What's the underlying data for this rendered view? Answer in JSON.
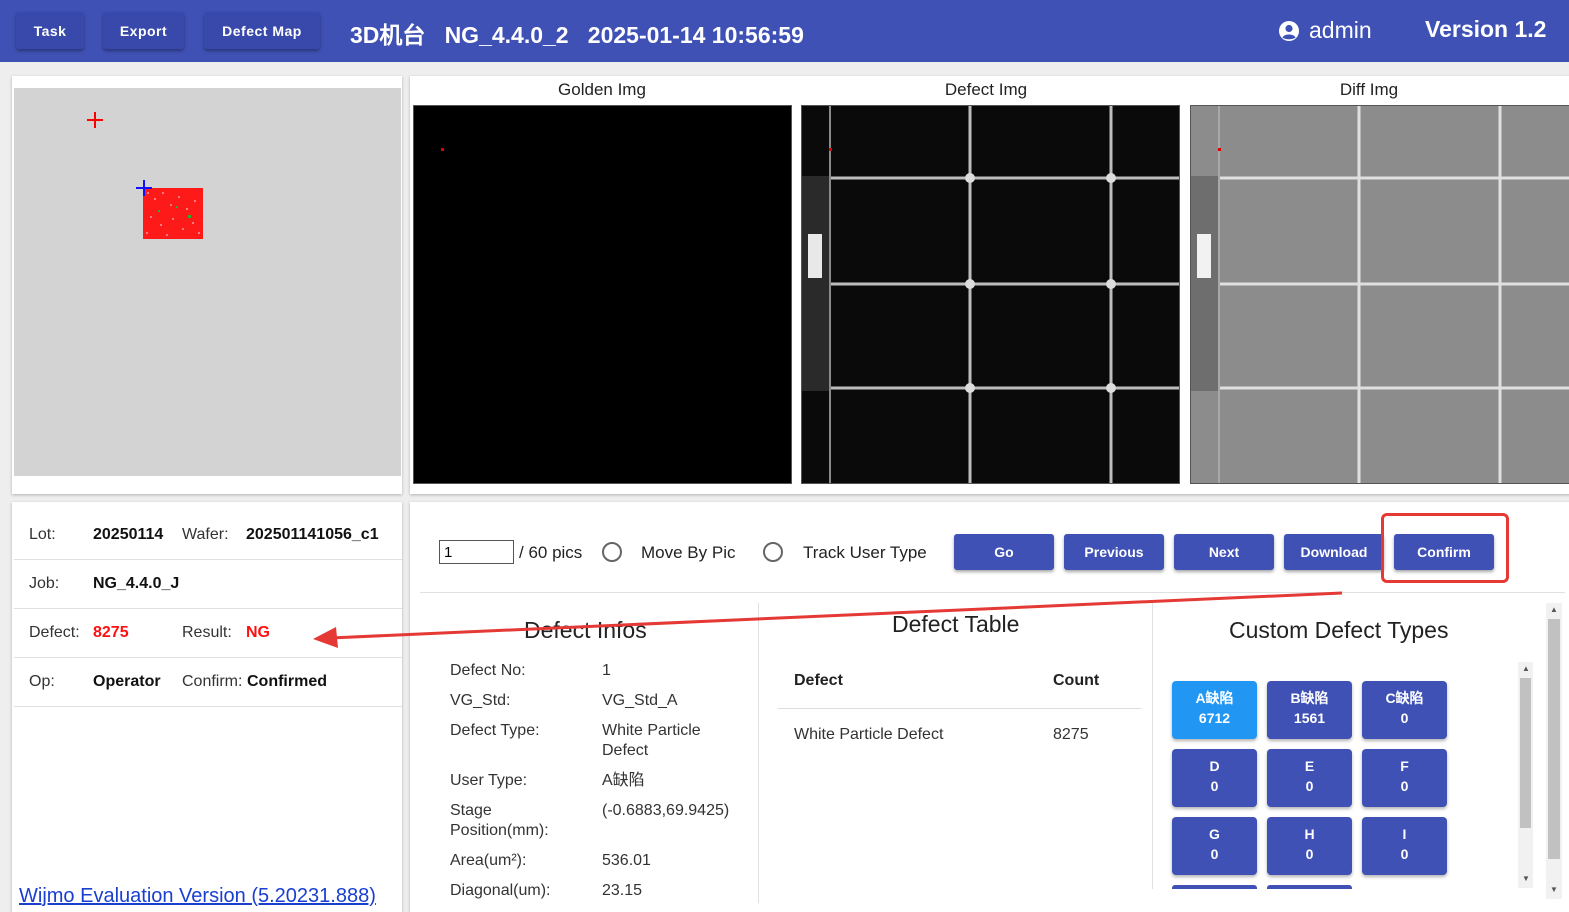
{
  "topbar": {
    "buttons": [
      "Task",
      "Export",
      "Defect Map"
    ],
    "title": "3D机台   NG_4.4.0_2   2025-01-14 10:56:59",
    "user": "admin",
    "version": "Version 1.2"
  },
  "images": {
    "golden_title": "Golden Img",
    "defect_title": "Defect Img",
    "diff_title": "Diff Img"
  },
  "info": {
    "lot_label": "Lot:",
    "lot": "20250114",
    "wafer_label": "Wafer:",
    "wafer": "202501141056_c1",
    "job_label": "Job:",
    "job": "NG_4.4.0_J",
    "defect_label": "Defect:",
    "defect": "8275",
    "result_label": "Result:",
    "result": "NG",
    "op_label": "Op:",
    "op": "Operator",
    "confirm_label": "Confirm:",
    "confirm": "Confirmed"
  },
  "watermark": "Wijmo Evaluation Version (5.20231.888)",
  "controls": {
    "pic_value": "1",
    "pic_total": "/ 60 pics",
    "move_by_pic": "Move By Pic",
    "track_user_type": "Track User Type",
    "go": "Go",
    "previous": "Previous",
    "next": "Next",
    "download": "Download",
    "confirm": "Confirm"
  },
  "defect_infos": {
    "title": "Defect Infos",
    "rows": [
      {
        "label": "Defect No:",
        "value": "1"
      },
      {
        "label": "VG_Std:",
        "value": "VG_Std_A"
      },
      {
        "label": "Defect Type:",
        "value": "White Particle Defect"
      },
      {
        "label": "User Type:",
        "value": "A缺陷"
      },
      {
        "label": "Stage Position(mm):",
        "value": "(-0.6883,69.9425)"
      },
      {
        "label": "Area(um²):",
        "value": "536.01"
      },
      {
        "label": "Diagonal(um):",
        "value": "23.15"
      }
    ]
  },
  "defect_table": {
    "title": "Defect Table",
    "headers": [
      "Defect",
      "Count"
    ],
    "rows": [
      {
        "defect": "White Particle Defect",
        "count": "8275"
      }
    ]
  },
  "custom_types": {
    "title": "Custom Defect Types",
    "buttons": [
      {
        "name": "A缺陷",
        "count": "6712"
      },
      {
        "name": "B缺陷",
        "count": "1561"
      },
      {
        "name": "C缺陷",
        "count": "0"
      },
      {
        "name": "D",
        "count": "0"
      },
      {
        "name": "E",
        "count": "0"
      },
      {
        "name": "F",
        "count": "0"
      },
      {
        "name": "G",
        "count": "0"
      },
      {
        "name": "H",
        "count": "0"
      },
      {
        "name": "I",
        "count": "0"
      }
    ]
  },
  "colors": {
    "primary": "#3f51b5",
    "active": "#2196f3",
    "alert": "#ff1010",
    "annotation": "#e53935"
  }
}
